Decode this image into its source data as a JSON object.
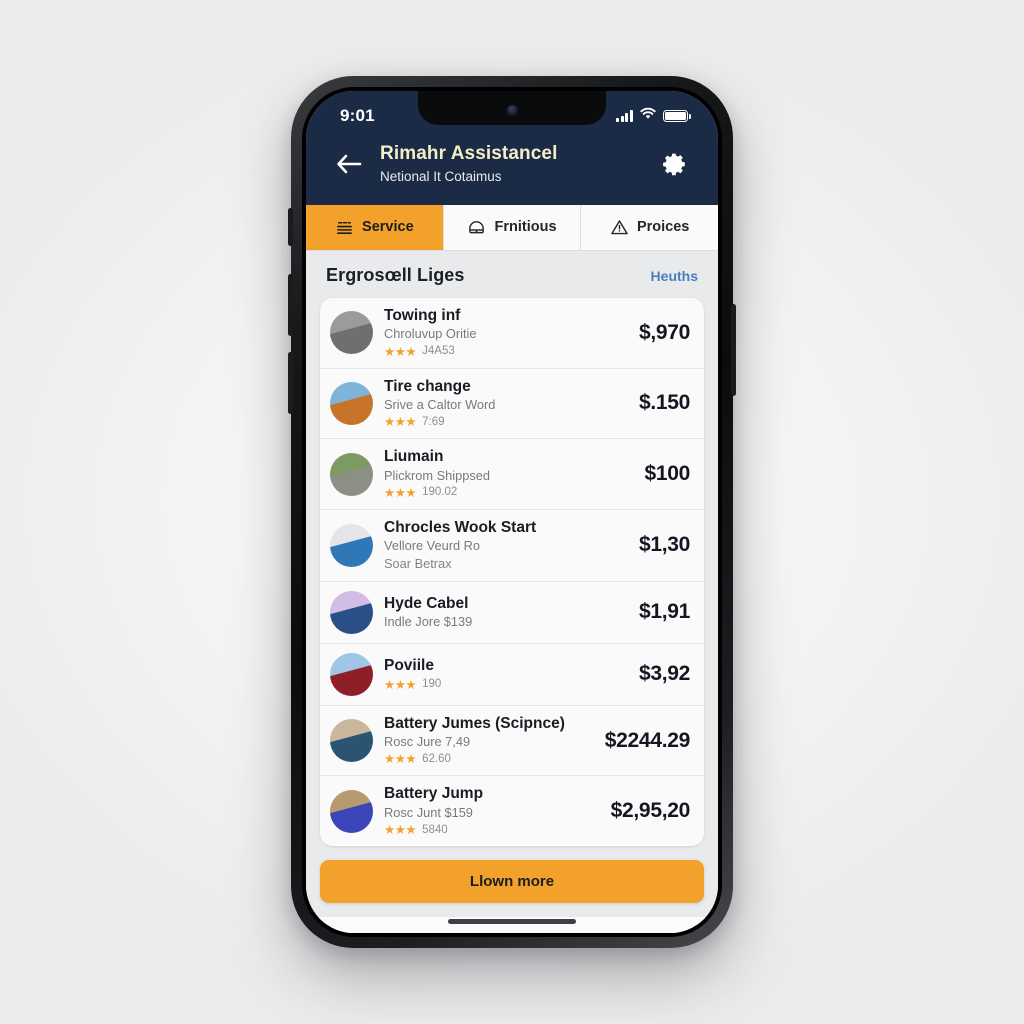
{
  "status_bar": {
    "clock": "9:01",
    "signal_icon": "cellular-bars-icon",
    "wifi_icon": "wifi-icon",
    "battery_icon": "battery-full-icon"
  },
  "header": {
    "back_icon": "arrow-left-icon",
    "title": "Rimahr Assistancel",
    "subtitle": "Netional It Cotaimus",
    "settings_icon": "gear-icon",
    "bg_color": "#1b2a45",
    "title_color": "#f2efc9"
  },
  "tabs": [
    {
      "label": "Service",
      "icon": "service-list-icon",
      "active": true
    },
    {
      "label": "Frnitious",
      "icon": "helmet-icon",
      "active": false
    },
    {
      "label": "Proices",
      "icon": "warning-triangle-icon",
      "active": false
    }
  ],
  "list": {
    "title": "Ergrosœll Liges",
    "action_label": "Heuths",
    "action_color": "#4a7fc1"
  },
  "services": [
    {
      "name": "Towing inf",
      "subtitle": "Chroluvup Oritie",
      "subtitle2": "",
      "stars": "★★★",
      "rating_count": "J4A53",
      "price": "$,970",
      "thumb_icon": "tow-truck-photo",
      "thumb_colors": [
        "#9b9c9a",
        "#6e706e"
      ]
    },
    {
      "name": "Tire change",
      "subtitle": "Srive a Caltor Word",
      "subtitle2": "",
      "stars": "★★★",
      "rating_count": "7:69",
      "price": "$.150",
      "thumb_icon": "orange-truck-photo",
      "thumb_colors": [
        "#7fb4d8",
        "#c7742a"
      ]
    },
    {
      "name": "Liumain",
      "subtitle": "Plickrom Shippsed",
      "subtitle2": "",
      "stars": "★★★",
      "rating_count": "190.02",
      "price": "$100",
      "thumb_icon": "roadside-photo",
      "thumb_colors": [
        "#7d9a62",
        "#8c8f84"
      ]
    },
    {
      "name": "Chrocles Wook Start",
      "subtitle": "Vellore Veurd Ro",
      "subtitle2": "Soar Betrax",
      "stars": "",
      "rating_count": "",
      "price": "$1,30",
      "thumb_icon": "blue-device-photo",
      "thumb_colors": [
        "#e6e4e8",
        "#2f78b8"
      ]
    },
    {
      "name": "Hyde Cabel",
      "subtitle": "Indle Jore $139",
      "subtitle2": "",
      "stars": "",
      "rating_count": "",
      "price": "$1,91",
      "thumb_icon": "blue-car-photo",
      "thumb_colors": [
        "#d3bde6",
        "#2a4f86"
      ]
    },
    {
      "name": "Poviile",
      "subtitle": "",
      "subtitle2": "",
      "stars": "★★★",
      "rating_count": "190",
      "price": "$3,92",
      "thumb_icon": "red-car-photo",
      "thumb_colors": [
        "#9fc6e4",
        "#8e1f29"
      ]
    },
    {
      "name": "Battery Jumes (Scipnce)",
      "subtitle": "Rosc Jure 7,49",
      "subtitle2": "",
      "stars": "★★★",
      "rating_count": "62.60",
      "price": "$2244.29",
      "thumb_icon": "helicopter-photo",
      "thumb_colors": [
        "#c9b89c",
        "#2b5472"
      ]
    },
    {
      "name": "Battery Jump",
      "subtitle": "Rosc Junt $159",
      "subtitle2": "",
      "stars": "★★★",
      "rating_count": "5840",
      "price": "$2,95,20",
      "thumb_icon": "battery-photo",
      "thumb_colors": [
        "#b89a72",
        "#3d46b8"
      ]
    }
  ],
  "cta": {
    "label": "Llown more",
    "color": "#f2a12a"
  }
}
